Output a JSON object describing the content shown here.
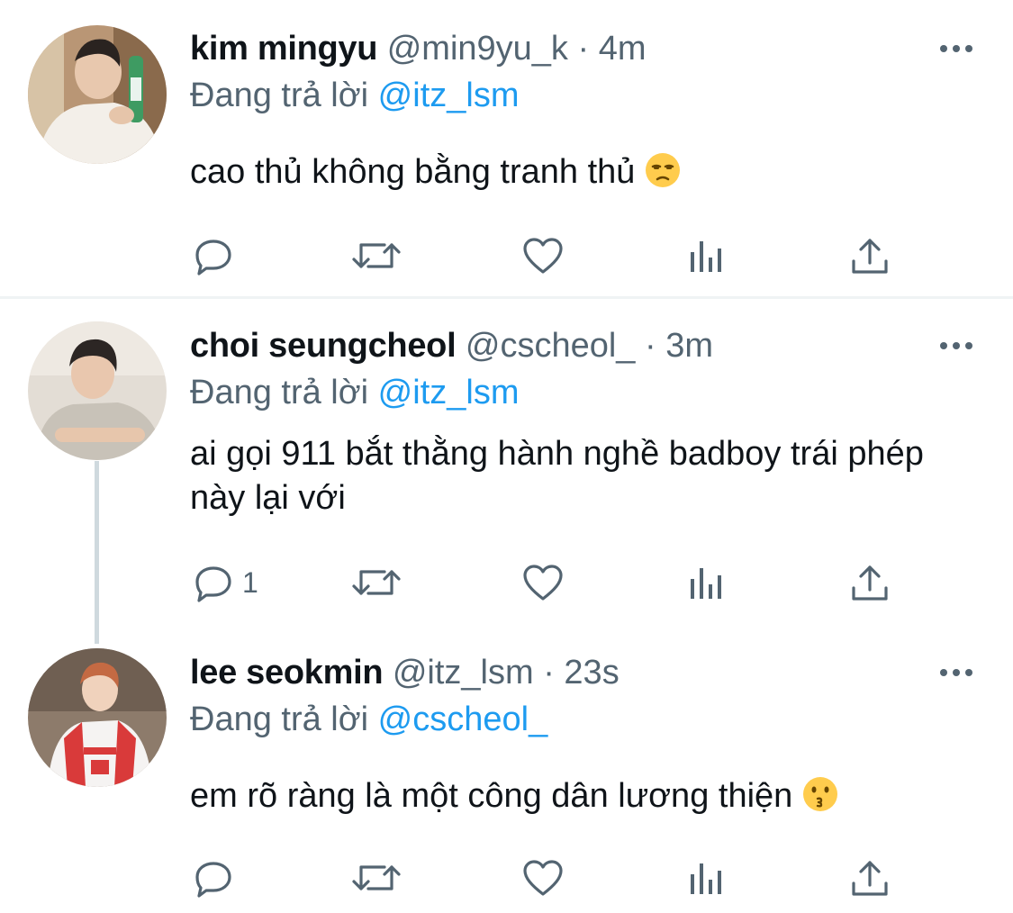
{
  "tweets": [
    {
      "name": "kim mingyu",
      "handle": "@min9yu_k",
      "separator": "·",
      "time": "4m",
      "replying_label": "Đang trả lời",
      "replying_to": "@itz_lsm",
      "text": "cao thủ không bằng tranh thủ",
      "emoji": "unamused-face-emoji",
      "reply_count": ""
    },
    {
      "name": "choi seungcheol",
      "handle": "@cscheol_",
      "separator": "·",
      "time": "3m",
      "replying_label": "Đang trả lời",
      "replying_to": "@itz_lsm",
      "text": "ai gọi 911 bắt thằng hành nghề badboy trái phép này lại với",
      "emoji": "",
      "reply_count": "1"
    },
    {
      "name": "lee seokmin",
      "handle": "@itz_lsm",
      "separator": "·",
      "time": "23s",
      "replying_label": "Đang trả lời",
      "replying_to": "@cscheol_",
      "text": "em rõ ràng là một công dân lương thiện",
      "emoji": "kissing-face-emoji",
      "reply_count": ""
    }
  ],
  "icons": {
    "reply": "reply-icon",
    "retweet": "retweet-icon",
    "like": "like-icon",
    "views": "views-icon",
    "share": "share-icon",
    "more": "more-icon"
  },
  "colors": {
    "text": "#0f1419",
    "secondary": "#536471",
    "link": "#1d9bf0",
    "divider": "#eff3f4",
    "thread_line": "#cfd9de"
  }
}
